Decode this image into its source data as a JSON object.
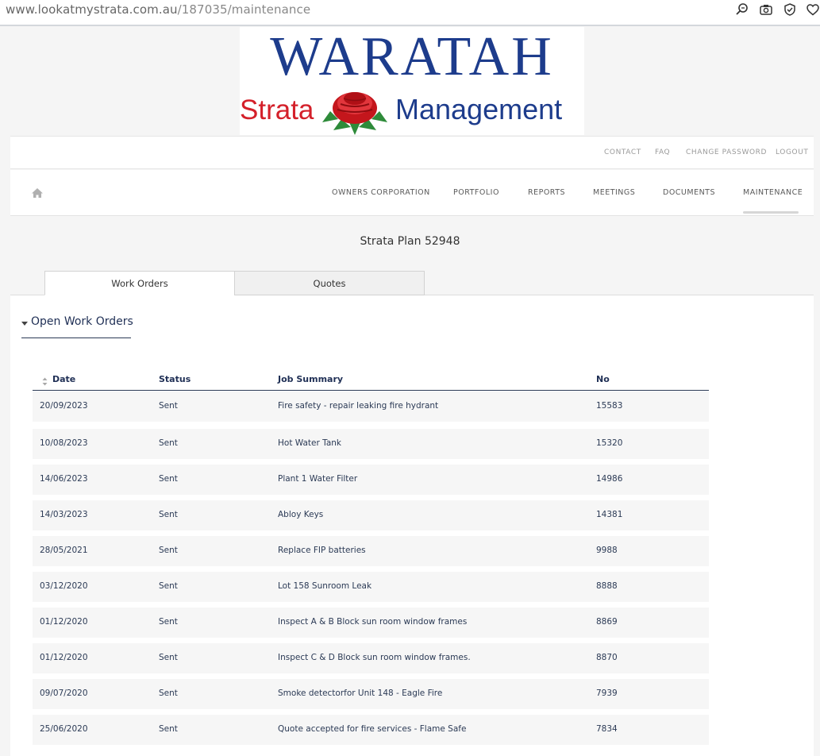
{
  "browser": {
    "url_domain": "www.lookatmystrata.com.au",
    "url_path": "/187035/maintenance",
    "icons": [
      "zoom-icon",
      "camera-icon",
      "shield-check-icon",
      "heart-icon"
    ]
  },
  "logo": {
    "line1": "WARATAH",
    "line2_left": "Strata",
    "line2_right": "Management",
    "colors": {
      "blue": "#1d3c8c",
      "red": "#d4202a",
      "green": "#2e8b3a"
    }
  },
  "topnav": {
    "contact": "CONTACT",
    "faq": "FAQ",
    "change_password": "CHANGE PASSWORD",
    "logout": "LOGOUT"
  },
  "mainnav": {
    "home_icon": "home-icon",
    "owners_corporation": "OWNERS CORPORATION",
    "portfolio": "PORTFOLIO",
    "reports": "REPORTS",
    "meetings": "MEETINGS",
    "documents": "DOCUMENTS",
    "maintenance": "MAINTENANCE",
    "active": "MAINTENANCE"
  },
  "page": {
    "plan_title": "Strata Plan 52948"
  },
  "tabs": {
    "work_orders": "Work Orders",
    "quotes": "Quotes",
    "active": "Work Orders"
  },
  "section": {
    "title": "Open Work Orders",
    "toggle_icon": "caret-down-icon"
  },
  "table": {
    "headers": {
      "date": "Date",
      "status": "Status",
      "job_summary": "Job Summary",
      "no": "No"
    },
    "sort_icon": "sort-icon",
    "rows": [
      {
        "date": "20/09/2023",
        "status": "Sent",
        "job": "Fire safety - repair leaking fire hydrant",
        "no": "15583"
      },
      {
        "date": "10/08/2023",
        "status": "Sent",
        "job": "Hot Water Tank",
        "no": "15320"
      },
      {
        "date": "14/06/2023",
        "status": "Sent",
        "job": "Plant 1 Water Filter",
        "no": "14986"
      },
      {
        "date": "14/03/2023",
        "status": "Sent",
        "job": "Abloy Keys",
        "no": "14381"
      },
      {
        "date": "28/05/2021",
        "status": "Sent",
        "job": "Replace FIP batteries",
        "no": "9988"
      },
      {
        "date": "03/12/2020",
        "status": "Sent",
        "job": "Lot 158 Sunroom Leak",
        "no": "8888"
      },
      {
        "date": "01/12/2020",
        "status": "Sent",
        "job": "Inspect A & B Block sun room window frames",
        "no": "8869"
      },
      {
        "date": "01/12/2020",
        "status": "Sent",
        "job": "Inspect C & D Block sun room window frames.",
        "no": "8870"
      },
      {
        "date": "09/07/2020",
        "status": "Sent",
        "job": "Smoke detectorfor Unit 148 - Eagle Fire",
        "no": "7939"
      },
      {
        "date": "25/06/2020",
        "status": "Sent",
        "job": "Quote accepted for fire services - Flame Safe",
        "no": "7834"
      }
    ]
  }
}
